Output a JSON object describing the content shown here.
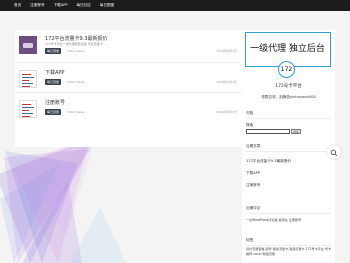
{
  "nav": {
    "items": [
      {
        "label": "首页"
      },
      {
        "label": "注册账号"
      },
      {
        "label": "下载APP"
      },
      {
        "label": "每日社区"
      },
      {
        "label": "每日图鉴"
      }
    ]
  },
  "posts": [
    {
      "title": "172平台流量卡9.3最新报价",
      "excerpt": "172号卡平台一级代理招商加盟 手机流量卡",
      "tag": "每日流量",
      "views": "1011 Views",
      "date": "2024年8月3日",
      "thumb_icon": "platform-logo-icon"
    },
    {
      "title": "下载APP",
      "excerpt": "",
      "tag": "每日流量",
      "views": "1901 Views",
      "date": "2024年8月3日",
      "thumb_icon": "document-icon"
    },
    {
      "title": "注册账号",
      "excerpt": "",
      "tag": "每日流量",
      "views": "1590 Views",
      "date": "2024年8月3日",
      "thumb_icon": "document-icon"
    }
  ],
  "sidebar": {
    "banner_text": "一级代理 独立后台",
    "badge_text": "172",
    "name": "172号卡平台",
    "wechat": "进群交流，加微信yinhoudan000",
    "search": {
      "title": "归档",
      "label": "搜索",
      "button": "搜索"
    },
    "recent": {
      "title": "近期文章",
      "items": [
        "172平台流量卡9.3最新报价",
        "下载APP",
        "注册账号"
      ]
    },
    "comments": {
      "title": "近期评论",
      "text": "一位WordPress评论者 发表在 注册账号"
    },
    "tags": {
      "title": "标签",
      "text": "低价流量套餐 靓号 移动流量卡 联通流量卡 172号卡平台 号卡推荐 novel 网络流量"
    }
  },
  "colors": {
    "nav_bg": "#1c1c1c",
    "tag_bg": "#3a4250",
    "banner_border": "#2fa0d6"
  }
}
